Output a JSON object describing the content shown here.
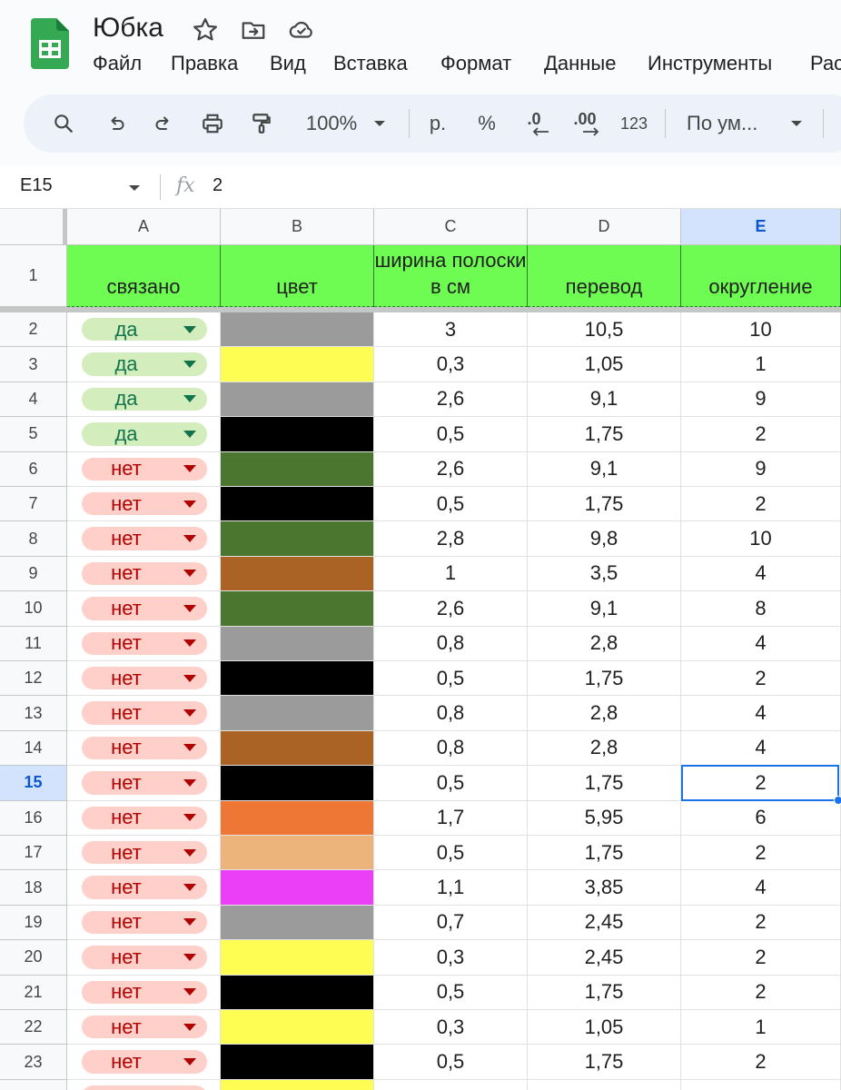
{
  "app": {
    "doc_title": "Юбка",
    "menu": [
      "Файл",
      "Правка",
      "Вид",
      "Вставка",
      "Формат",
      "Данные",
      "Инструменты",
      "Рас"
    ],
    "icons": [
      "sheets-logo-icon",
      "star-icon",
      "move-to-folder-icon",
      "cloud-saved-icon"
    ]
  },
  "toolbar": {
    "zoom": "100%",
    "currency": "р.",
    "percent": "%",
    "decrease_decimal": ".0",
    "increase_decimal": ".00",
    "number_format": "123",
    "font": "По ум...",
    "icons": [
      "search-icon",
      "undo-icon",
      "redo-icon",
      "print-icon",
      "paint-format-icon",
      "chevron-down-icon"
    ]
  },
  "formula_bar": {
    "cell_ref": "E15",
    "fx": "fx",
    "value": "2"
  },
  "columns": [
    "A",
    "B",
    "C",
    "D",
    "E"
  ],
  "selected_column": "E",
  "selected_row": "15",
  "header_row": {
    "row_number": "1",
    "cells": [
      "связано",
      "цвет",
      "ширина полоски в см",
      "перевод",
      "округление"
    ],
    "background": "#6efc53"
  },
  "rows": [
    {
      "n": "2",
      "status": "да",
      "color": "#9b9b9b",
      "width": "3",
      "conv": "10,5",
      "round": "10"
    },
    {
      "n": "3",
      "status": "да",
      "color": "#fefd53",
      "width": "0,3",
      "conv": "1,05",
      "round": "1"
    },
    {
      "n": "4",
      "status": "да",
      "color": "#9b9b9b",
      "width": "2,6",
      "conv": "9,1",
      "round": "9"
    },
    {
      "n": "5",
      "status": "да",
      "color": "#000000",
      "width": "0,5",
      "conv": "1,75",
      "round": "2"
    },
    {
      "n": "6",
      "status": "нет",
      "color": "#4a762f",
      "width": "2,6",
      "conv": "9,1",
      "round": "9"
    },
    {
      "n": "7",
      "status": "нет",
      "color": "#000000",
      "width": "0,5",
      "conv": "1,75",
      "round": "2"
    },
    {
      "n": "8",
      "status": "нет",
      "color": "#4a762f",
      "width": "2,8",
      "conv": "9,8",
      "round": "10"
    },
    {
      "n": "9",
      "status": "нет",
      "color": "#aa6225",
      "width": "1",
      "conv": "3,5",
      "round": "4"
    },
    {
      "n": "10",
      "status": "нет",
      "color": "#4a762f",
      "width": "2,6",
      "conv": "9,1",
      "round": "8"
    },
    {
      "n": "11",
      "status": "нет",
      "color": "#9b9b9b",
      "width": "0,8",
      "conv": "2,8",
      "round": "4"
    },
    {
      "n": "12",
      "status": "нет",
      "color": "#000000",
      "width": "0,5",
      "conv": "1,75",
      "round": "2"
    },
    {
      "n": "13",
      "status": "нет",
      "color": "#9b9b9b",
      "width": "0,8",
      "conv": "2,8",
      "round": "4"
    },
    {
      "n": "14",
      "status": "нет",
      "color": "#aa6225",
      "width": "0,8",
      "conv": "2,8",
      "round": "4"
    },
    {
      "n": "15",
      "status": "нет",
      "color": "#000000",
      "width": "0,5",
      "conv": "1,75",
      "round": "2"
    },
    {
      "n": "16",
      "status": "нет",
      "color": "#ef7735",
      "width": "1,7",
      "conv": "5,95",
      "round": "6"
    },
    {
      "n": "17",
      "status": "нет",
      "color": "#ecb47b",
      "width": "0,5",
      "conv": "1,75",
      "round": "2"
    },
    {
      "n": "18",
      "status": "нет",
      "color": "#ea3ef7",
      "width": "1,1",
      "conv": "3,85",
      "round": "4"
    },
    {
      "n": "19",
      "status": "нет",
      "color": "#9b9b9b",
      "width": "0,7",
      "conv": "2,45",
      "round": "2"
    },
    {
      "n": "20",
      "status": "нет",
      "color": "#fefd53",
      "width": "0,3",
      "conv": "2,45",
      "round": "2"
    },
    {
      "n": "21",
      "status": "нет",
      "color": "#000000",
      "width": "0,5",
      "conv": "1,75",
      "round": "2"
    },
    {
      "n": "22",
      "status": "нет",
      "color": "#fefd53",
      "width": "0,3",
      "conv": "1,05",
      "round": "1"
    },
    {
      "n": "23",
      "status": "нет",
      "color": "#000000",
      "width": "0,5",
      "conv": "1,75",
      "round": "2"
    },
    {
      "n": "",
      "status": "нет",
      "color": "#fefd53",
      "width": "",
      "conv": "",
      "round": ""
    }
  ],
  "status_values": {
    "yes": "да",
    "no": "нет"
  },
  "colors": {
    "accent": "#1a73e8",
    "yes_chip_bg": "#d4edbc",
    "yes_chip_text": "#11734b",
    "no_chip_bg": "#ffcfc9",
    "no_chip_text": "#b10202"
  }
}
